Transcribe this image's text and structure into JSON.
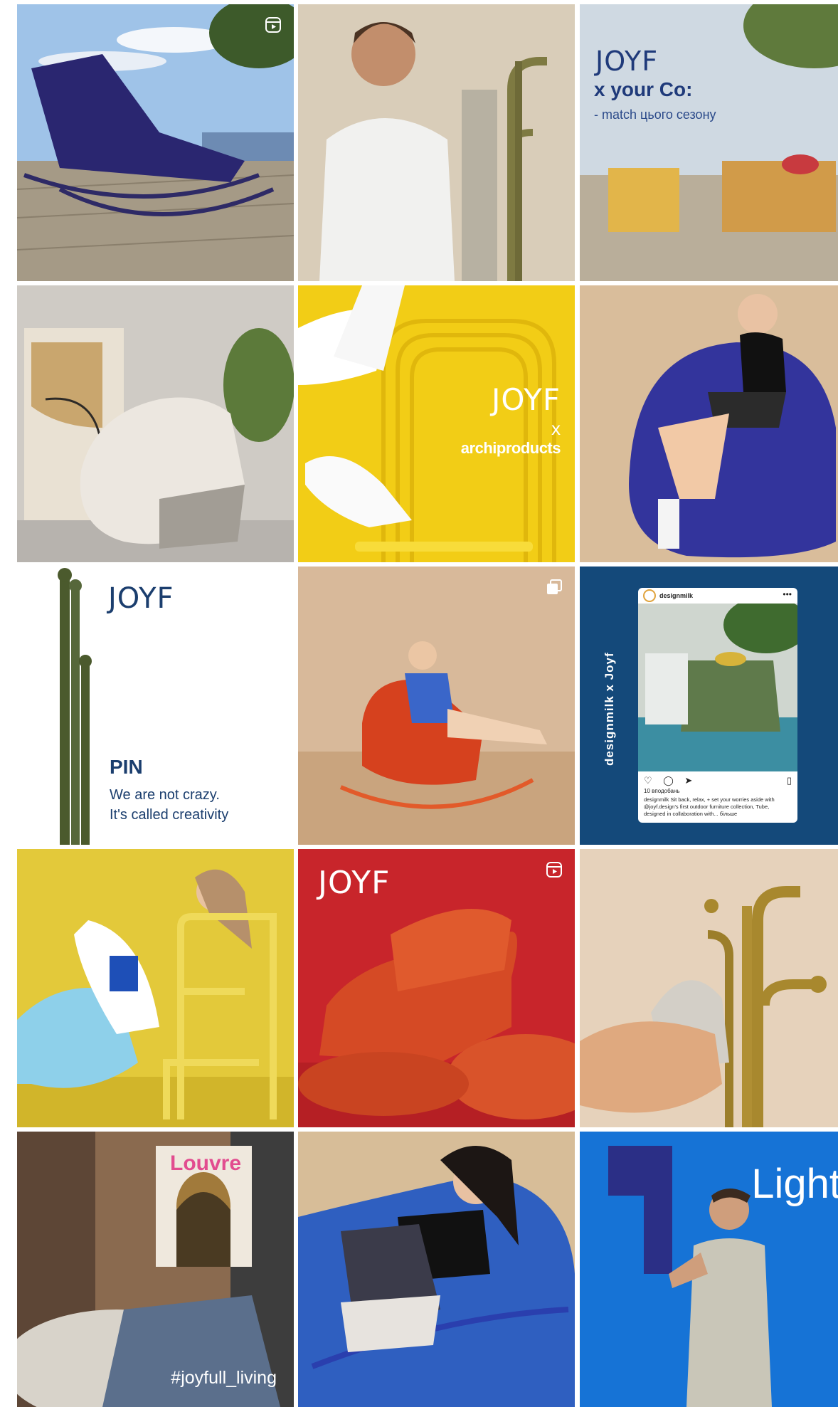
{
  "feed": {
    "posts": [
      {
        "id": "1",
        "badge": "reel-icon"
      },
      {
        "id": "2"
      },
      {
        "id": "3",
        "logo": "JOYF",
        "line1": "x your Co:",
        "line2": "- match цього сезону"
      },
      {
        "id": "4"
      },
      {
        "id": "5",
        "logo": "JOYF",
        "line1": "x",
        "line2": "archiproducts"
      },
      {
        "id": "6"
      },
      {
        "id": "7",
        "logo": "JOYF",
        "title": "PIN",
        "line1": "We are not crazy.",
        "line2": "It's called creativity"
      },
      {
        "id": "8",
        "badge": "carousel-icon"
      },
      {
        "id": "9",
        "side_text": "designmilk x Joyf",
        "account": "designmilk",
        "date": "10 вподобань",
        "caption": "designmilk Sit back, relax, + set your worries aside with @joyf.design's first outdoor furniture collection, Tube, designed in collaboration with... більше"
      },
      {
        "id": "10"
      },
      {
        "id": "11",
        "logo": "JOYF",
        "badge": "reel-icon"
      },
      {
        "id": "12"
      },
      {
        "id": "13",
        "magazine": "Louvre",
        "hashtag": "#joyfull_living"
      },
      {
        "id": "14"
      },
      {
        "id": "15",
        "headline": "Light"
      }
    ]
  },
  "colors": {
    "brand_blue": "#1f3a7a",
    "yellow": "#f4cf1c",
    "red": "#c8252b",
    "navy": "#14497a",
    "blue": "#1673d6"
  }
}
